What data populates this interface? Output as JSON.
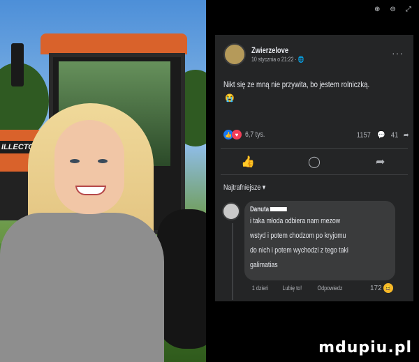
{
  "top_bar": {
    "icons": [
      "zoom-in-icon",
      "zoom-out-icon",
      "expand-icon"
    ]
  },
  "photo": {
    "tractor_text": "ILLECTOR"
  },
  "post": {
    "author": "Zwierzelove",
    "date": "10 stycznia o 21:22 ·",
    "text": "Nikt się ze mną nie przywita, bo jestem rolniczką.",
    "emoji": "😭",
    "reaction_count": "6,7 tys.",
    "comment_count": "1157",
    "share_count": "41"
  },
  "actions": [
    "like-icon",
    "comment-icon",
    "share-icon"
  ],
  "sort_label": "Najtrafniejsze ▾",
  "comment": {
    "author": "Danuta",
    "lines": [
      "i taka młoda odbiera nam mezow",
      "wstyd i potem chodzom po kryjomu",
      "do nich i potem wychodzi z tego taki",
      "galimatias"
    ],
    "time": "1 dzień",
    "like_label": "Lubię to!",
    "reply_label": "Odpowiedz",
    "reaction_count": "172"
  },
  "watermark": "mdupiu.pl"
}
